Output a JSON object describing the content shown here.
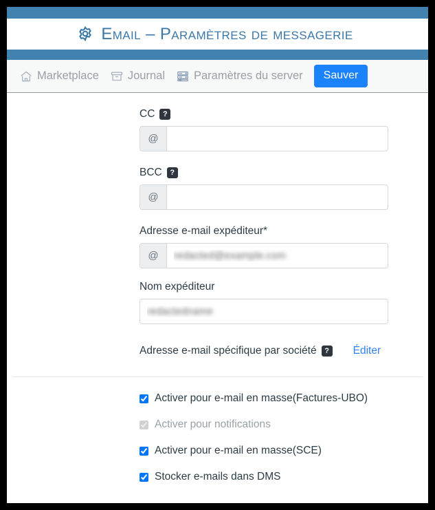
{
  "header": {
    "gear_icon": "gear-icon",
    "title": "Email – Paramètres de messagerie",
    "bar_color": "#4282b0",
    "title_color": "#3b78a8"
  },
  "toolbar": {
    "items": [
      {
        "icon": "home-icon",
        "label": "Marketplace"
      },
      {
        "icon": "archive-box-icon",
        "label": "Journal"
      },
      {
        "icon": "server-rack-icon",
        "label": "Paramètres du server"
      }
    ],
    "save_label": "Sauver",
    "save_color": "#1a82fb"
  },
  "form": {
    "cc": {
      "label": "CC",
      "help": "?",
      "prefix": "@",
      "value": "",
      "placeholder": ""
    },
    "bcc": {
      "label": "BCC",
      "help": "?",
      "prefix": "@",
      "value": "",
      "placeholder": ""
    },
    "sender_email": {
      "label": "Adresse e-mail expéditeur*",
      "prefix": "@",
      "value": "redacted@example.com",
      "placeholder": ""
    },
    "sender_name": {
      "label": "Nom expéditeur",
      "value": "redactedname",
      "placeholder": ""
    },
    "company_specific": {
      "label": "Adresse e-mail spécifique par société",
      "help": "?",
      "edit_label": "Éditer",
      "edit_color": "#2f7ff5"
    }
  },
  "options": [
    {
      "label": "Activer pour e-mail en masse(Factures-UBO)",
      "checked": true,
      "disabled": false
    },
    {
      "label": "Activer pour notifications",
      "checked": true,
      "disabled": true
    },
    {
      "label": "Activer pour e-mail en masse(SCE)",
      "checked": true,
      "disabled": false
    },
    {
      "label": "Stocker e-mails dans DMS",
      "checked": true,
      "disabled": false
    }
  ]
}
